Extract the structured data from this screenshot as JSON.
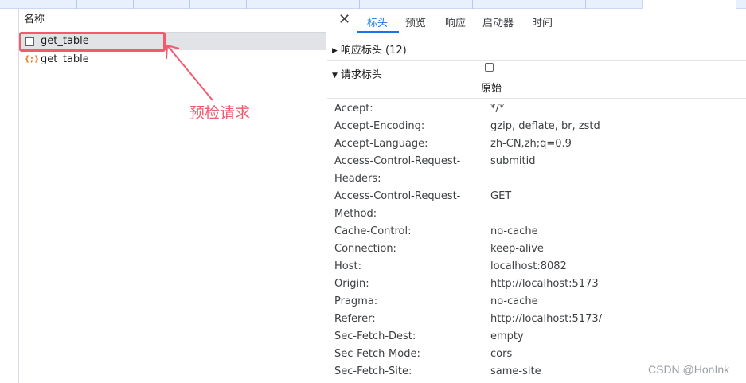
{
  "left_panel": {
    "column_header": "名称",
    "requests": [
      {
        "name": "get_table",
        "type": "document",
        "selected": true
      },
      {
        "name": "get_table",
        "type": "xhr",
        "selected": false
      }
    ]
  },
  "annotation": {
    "text": "预检请求",
    "color": "#f25b6d"
  },
  "right_panel": {
    "tabs": [
      "标头",
      "预览",
      "响应",
      "启动器",
      "时间"
    ],
    "active_tab": "标头",
    "response_headers_section": "响应标头 (12)",
    "request_headers_section": "请求标头",
    "raw_label": "原始",
    "headers": [
      {
        "name": "Accept:",
        "value": "*/*"
      },
      {
        "name": "Accept-Encoding:",
        "value": "gzip, deflate, br, zstd"
      },
      {
        "name": "Accept-Language:",
        "value": "zh-CN,zh;q=0.9"
      },
      {
        "name": "Access-Control-Request-",
        "name2": "Headers:",
        "value": "submitid"
      },
      {
        "name": "Access-Control-Request-",
        "name2": "Method:",
        "value": "GET"
      },
      {
        "name": "Cache-Control:",
        "value": "no-cache"
      },
      {
        "name": "Connection:",
        "value": "keep-alive"
      },
      {
        "name": "Host:",
        "value": "localhost:8082"
      },
      {
        "name": "Origin:",
        "value": "http://localhost:5173"
      },
      {
        "name": "Pragma:",
        "value": "no-cache"
      },
      {
        "name": "Referer:",
        "value": "http://localhost:5173/"
      },
      {
        "name": "Sec-Fetch-Dest:",
        "value": "empty"
      },
      {
        "name": "Sec-Fetch-Mode:",
        "value": "cors"
      },
      {
        "name": "Sec-Fetch-Site:",
        "value": "same-site"
      }
    ]
  },
  "icons": {
    "close": "close-icon",
    "document": "document-icon",
    "xhr": "xhr-braces-icon"
  },
  "watermark": "CSDN @HonInk",
  "colors": {
    "accent": "#1a73e8",
    "highlight": "#f25b6d",
    "selected_row": "#e1e3e6"
  }
}
